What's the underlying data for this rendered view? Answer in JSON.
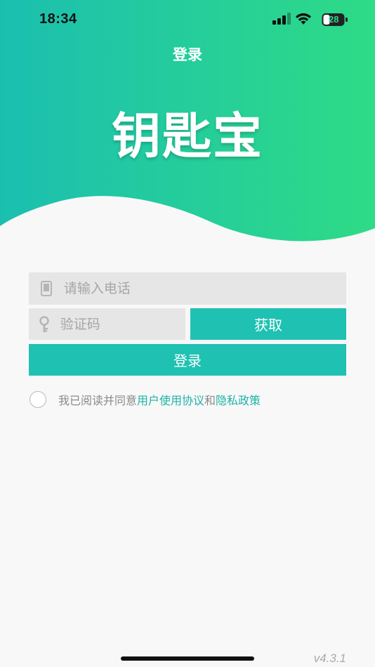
{
  "status_bar": {
    "time": "18:34",
    "battery": "28",
    "icons": [
      "signal-icon",
      "wifi-icon",
      "battery-icon"
    ]
  },
  "header": {
    "title": "登录",
    "logo_text": "钥匙宝"
  },
  "form": {
    "phone_placeholder": "请输入电话",
    "code_placeholder": "验证码",
    "get_code_label": "获取",
    "login_label": "登录",
    "phone_icon": "phone-icon",
    "key_icon": "key-icon"
  },
  "agreement": {
    "prefix": "我已阅读并同意",
    "user_agreement": "用户使用协议",
    "and": "和",
    "privacy_policy": "隐私政策"
  },
  "version": "v4.3.1",
  "colors": {
    "accent": "#1fc1b2",
    "gradient_start": "#1bbfb0",
    "gradient_end": "#2edb86",
    "link": "#1fb3a6",
    "field_bg": "#e6e6e6",
    "page_bg": "#f8f8f8"
  }
}
